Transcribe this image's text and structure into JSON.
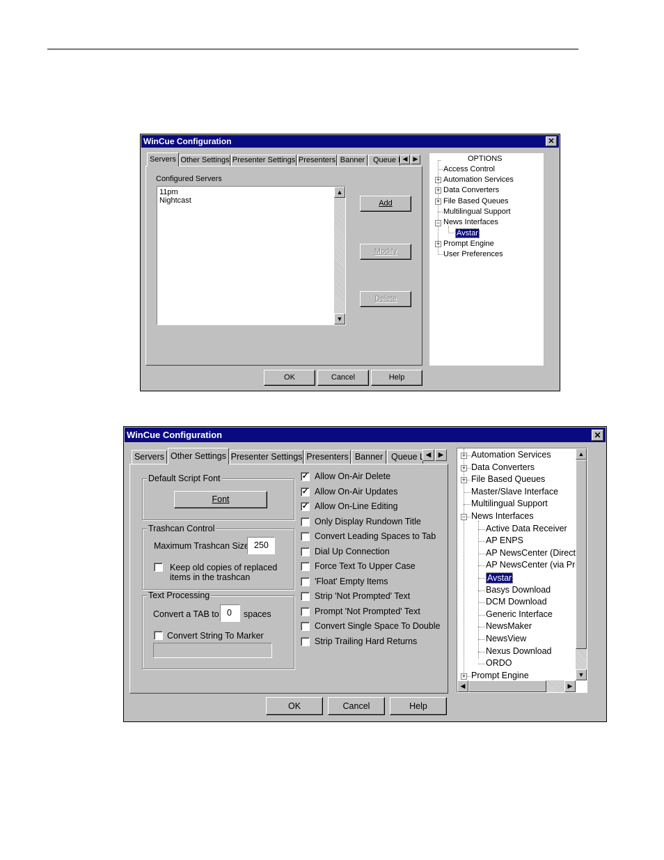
{
  "dialog1": {
    "title": "WinCue Configuration",
    "tabs": [
      "Servers",
      "Other Settings",
      "Presenter Settings",
      "Presenters",
      "Banner",
      "Queue L"
    ],
    "configured_servers_label": "Configured Servers",
    "servers": [
      "11pm",
      "Nightcast"
    ],
    "buttons": {
      "add": "Add",
      "modify": "Modify",
      "delete": "Delete"
    },
    "footer": {
      "ok": "OK",
      "cancel": "Cancel",
      "help": "Help"
    },
    "tree": {
      "root": "OPTIONS",
      "items": [
        "Access Control",
        "Automation Services",
        "Data Converters",
        "File Based Queues",
        "Multilingual Support",
        "News Interfaces",
        "Avstar",
        "Prompt Engine",
        "User Preferences"
      ]
    }
  },
  "dialog2": {
    "title": "WinCue Configuration",
    "tabs": [
      "Servers",
      "Other Settings",
      "Presenter Settings",
      "Presenters",
      "Banner",
      "Queue L"
    ],
    "default_script_font": {
      "legend": "Default Script Font",
      "button": "Font"
    },
    "trashcan": {
      "legend": "Trashcan Control",
      "max_label": "Maximum Trashcan Size",
      "max_value": "250",
      "keep_label_1": "Keep old copies of replaced",
      "keep_label_2": "items in the trashcan",
      "keep_checked": false
    },
    "text_processing": {
      "legend": "Text Processing",
      "convert_tab_label": "Convert a TAB to",
      "tab_value": "0",
      "spaces_label": "spaces",
      "convert_marker_label": "Convert String To Marker",
      "marker_value": ""
    },
    "options": [
      {
        "label": "Allow On-Air Delete",
        "checked": true
      },
      {
        "label": "Allow On-Air Updates",
        "checked": true
      },
      {
        "label": "Allow On-Line Editing",
        "checked": true
      },
      {
        "label": "Only Display Rundown Title",
        "checked": false
      },
      {
        "label": "Convert Leading Spaces to Tab",
        "checked": false
      },
      {
        "label": "Dial Up Connection",
        "checked": false
      },
      {
        "label": "Force Text To Upper Case",
        "checked": false
      },
      {
        "label": "'Float' Empty Items",
        "checked": false
      },
      {
        "label": "Strip 'Not Prompted' Text",
        "checked": false
      },
      {
        "label": "Prompt 'Not Prompted' Text",
        "checked": false
      },
      {
        "label": "Convert Single Space To Double",
        "checked": false
      },
      {
        "label": "Strip Trailing Hard Returns",
        "checked": false
      }
    ],
    "footer": {
      "ok": "OK",
      "cancel": "Cancel",
      "help": "Help"
    },
    "tree": {
      "items": [
        "Automation Services",
        "Data Converters",
        "File Based Queues",
        "Master/Slave Interface",
        "Multilingual Support",
        "News Interfaces"
      ],
      "children": [
        "Active Data Receiver",
        "AP ENPS",
        "AP NewsCenter (Direct)",
        "AP NewsCenter (via Pro",
        "Avstar",
        "Basys Download",
        "DCM Download",
        "Generic Interface",
        "NewsMaker",
        "NewsView",
        "Nexus Download",
        "ORDO"
      ],
      "last": "Prompt Engine",
      "selected": "Avstar"
    }
  }
}
